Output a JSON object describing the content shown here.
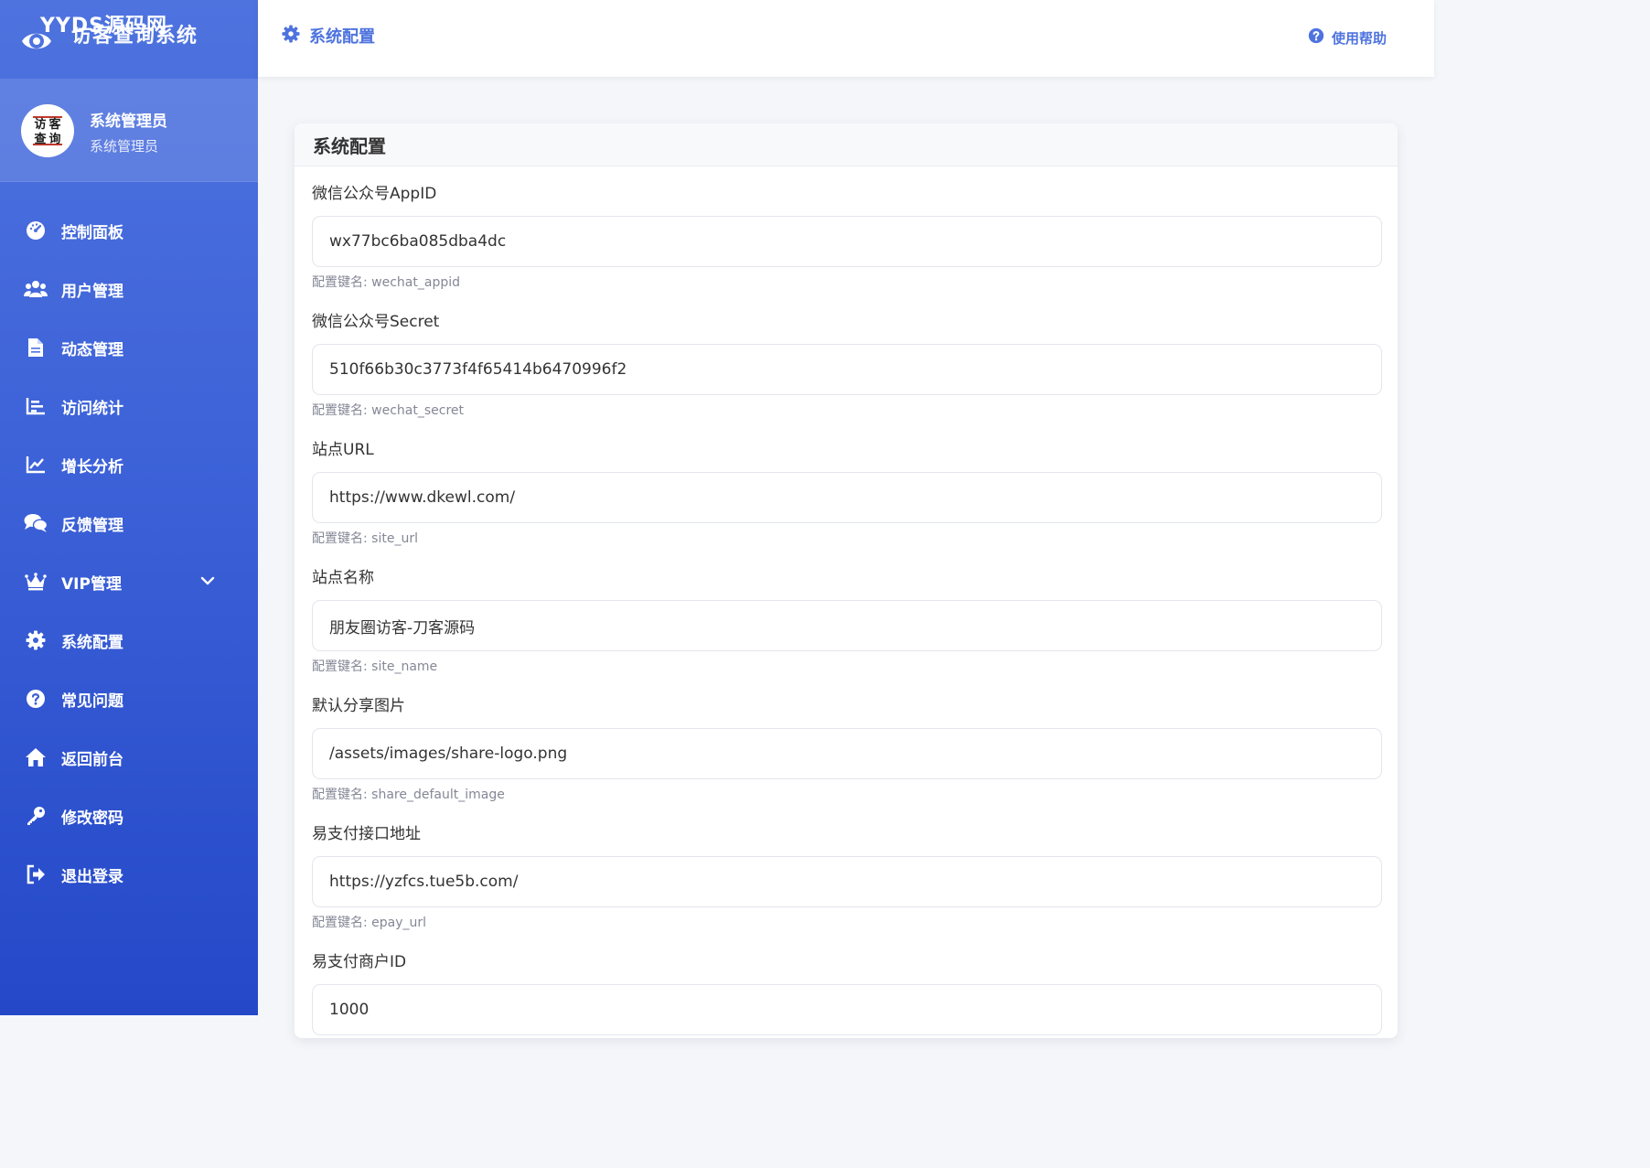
{
  "brand": {
    "overlay_text": "YYDS源码网",
    "title": "访客查询系统"
  },
  "user": {
    "name": "系统管理员",
    "role": "系统管理员",
    "avatar_chars": [
      "访",
      "客",
      "查",
      "询"
    ]
  },
  "menu": [
    {
      "label": "控制面板",
      "icon": "tachometer-icon"
    },
    {
      "label": "用户管理",
      "icon": "users-icon"
    },
    {
      "label": "动态管理",
      "icon": "file-icon"
    },
    {
      "label": "访问统计",
      "icon": "bar-chart-icon"
    },
    {
      "label": "增长分析",
      "icon": "line-chart-icon"
    },
    {
      "label": "反馈管理",
      "icon": "comments-icon"
    },
    {
      "label": "VIP管理",
      "icon": "crown-icon"
    },
    {
      "label": "系统配置",
      "icon": "gear-icon"
    },
    {
      "label": "常见问题",
      "icon": "question-circle-icon"
    },
    {
      "label": "返回前台",
      "icon": "home-icon"
    },
    {
      "label": "修改密码",
      "icon": "key-icon"
    },
    {
      "label": "退出登录",
      "icon": "sign-out-icon"
    }
  ],
  "header": {
    "title": "系统配置",
    "help_label": "使用帮助"
  },
  "card": {
    "title": "系统配置"
  },
  "fields": [
    {
      "label": "微信公众号AppID",
      "value": "wx77bc6ba085dba4dc",
      "hint": "配置键名: wechat_appid"
    },
    {
      "label": "微信公众号Secret",
      "value": "510f66b30c3773f4f65414b6470996f2",
      "hint": "配置键名: wechat_secret"
    },
    {
      "label": "站点URL",
      "value": "https://www.dkewl.com/",
      "hint": "配置键名: site_url"
    },
    {
      "label": "站点名称",
      "value": "朋友圈访客-刀客源码",
      "hint": "配置键名: site_name"
    },
    {
      "label": "默认分享图片",
      "value": "/assets/images/share-logo.png",
      "hint": "配置键名: share_default_image"
    },
    {
      "label": "易支付接口地址",
      "value": "https://yzfcs.tue5b.com/",
      "hint": "配置键名: epay_url"
    },
    {
      "label": "易支付商户ID",
      "value": "1000",
      "hint": ""
    }
  ],
  "colors": {
    "primary": "#4e73df",
    "sidebar_bottom": "#2448c8"
  }
}
